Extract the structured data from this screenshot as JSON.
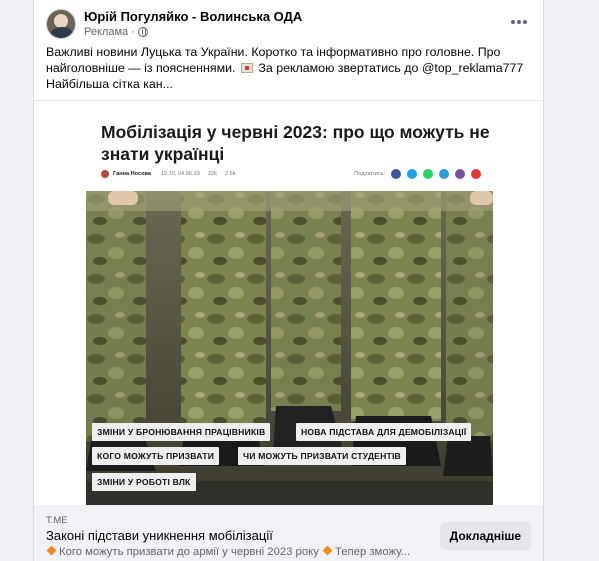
{
  "post": {
    "page_name": "Юрій Погуляйко - Волинська ОДА",
    "sponsored_label": "Реклама ·",
    "text_part1": "Важливі новини Луцька та України. Коротко та інформативно про головне. Про найголовніше — із поясненнями.",
    "text_part2": "За рекламою звертатись до @top_reklama777 Найбільша сітка кан..."
  },
  "article": {
    "title": "Мобілізація у червні 2023: про що можуть не знати українці",
    "author": "Ганна Носова",
    "date": "12:15, 04.06.23",
    "views": "22k",
    "comments": "2.6k",
    "share_label": "Поділитись:",
    "share_colors": [
      "#3b5998",
      "#1da1f2",
      "#25d366",
      "#2a9fd8",
      "#7b519d",
      "#e53935"
    ],
    "tags": [
      "ЗМІНИ У БРОНЮВАННЯ ПРАЦІВНИКІВ",
      "НОВА ПІДСТАВА ДЛЯ ДЕМОБІЛІЗАЦІЇ",
      "КОГО МОЖУТЬ ПРИЗВАТИ",
      "ЧИ МОЖУТЬ ПРИЗВАТИ СТУДЕНТІВ",
      "ЗМІНИ У РОБОТІ ВЛК"
    ]
  },
  "link": {
    "domain": "T.ME",
    "title": "Законі підстави уникнення мобілізації",
    "desc_part1": "Кого можуть призвати до армії у червні 2023 року",
    "desc_part2": "Тепер зможу...",
    "button_label": "Докладніше"
  },
  "icons": {
    "more": "more-horizontal-icon",
    "globe": "globe-icon",
    "mail": "envelope-icon",
    "diamond": "orange-diamond-icon"
  }
}
